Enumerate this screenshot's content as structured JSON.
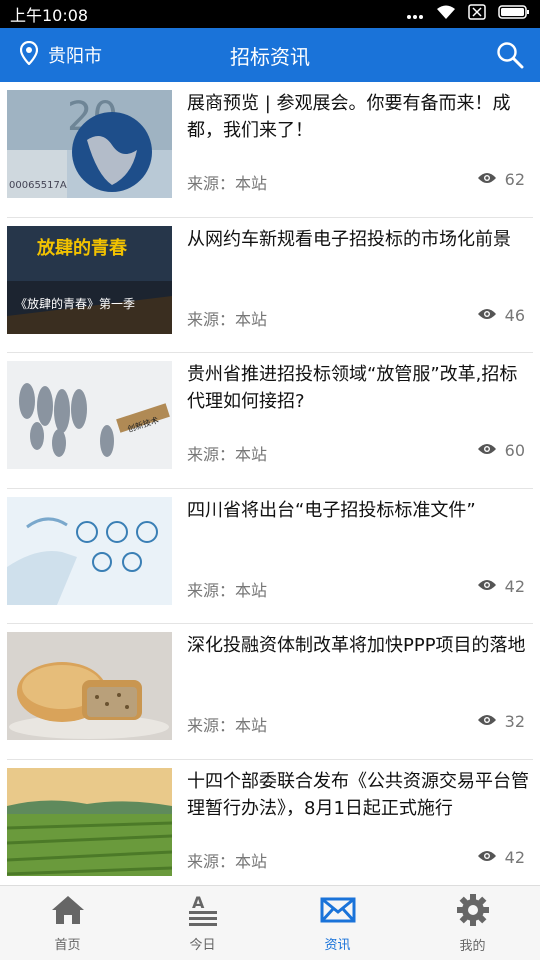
{
  "status": {
    "time": "上午10:08"
  },
  "header": {
    "location": "贵阳市",
    "title": "招标资讯"
  },
  "articles": [
    {
      "title": "展商预览 | 参观展会。你要有备而来！成都，我们来了！",
      "source": "来源：本站",
      "views": "62",
      "image": "money-globe"
    },
    {
      "title": "从网约车新规看电子招投标的市场化前景",
      "source": "来源：本站",
      "views": "46",
      "image": "tv-show",
      "image_caption": "《放肆的青春》第一季"
    },
    {
      "title": "贵州省推进招投标领域“放管服”改革,招标代理如何接招?",
      "source": "来源：本站",
      "views": "60",
      "image": "running-figures"
    },
    {
      "title": "四川省将出台“电子招投标标准文件”",
      "source": "来源：本站",
      "views": "42",
      "image": "tech-hand"
    },
    {
      "title": "深化投融资体制改革将加快PPP项目的落地",
      "source": "来源：本站",
      "views": "32",
      "image": "mooncake"
    },
    {
      "title": "十四个部委联合发布《公共资源交易平台管理暂行办法》，8月1日起正式施行",
      "source": "来源：本站",
      "views": "42",
      "image": "farm-field"
    }
  ],
  "tabs": [
    {
      "label": "首页",
      "icon": "home-icon"
    },
    {
      "label": "今日",
      "icon": "today-icon"
    },
    {
      "label": "资讯",
      "icon": "mail-icon",
      "active": true
    },
    {
      "label": "我的",
      "icon": "gear-icon"
    }
  ],
  "colors": {
    "accent": "#1a73d9",
    "statusbar": "#000000"
  }
}
